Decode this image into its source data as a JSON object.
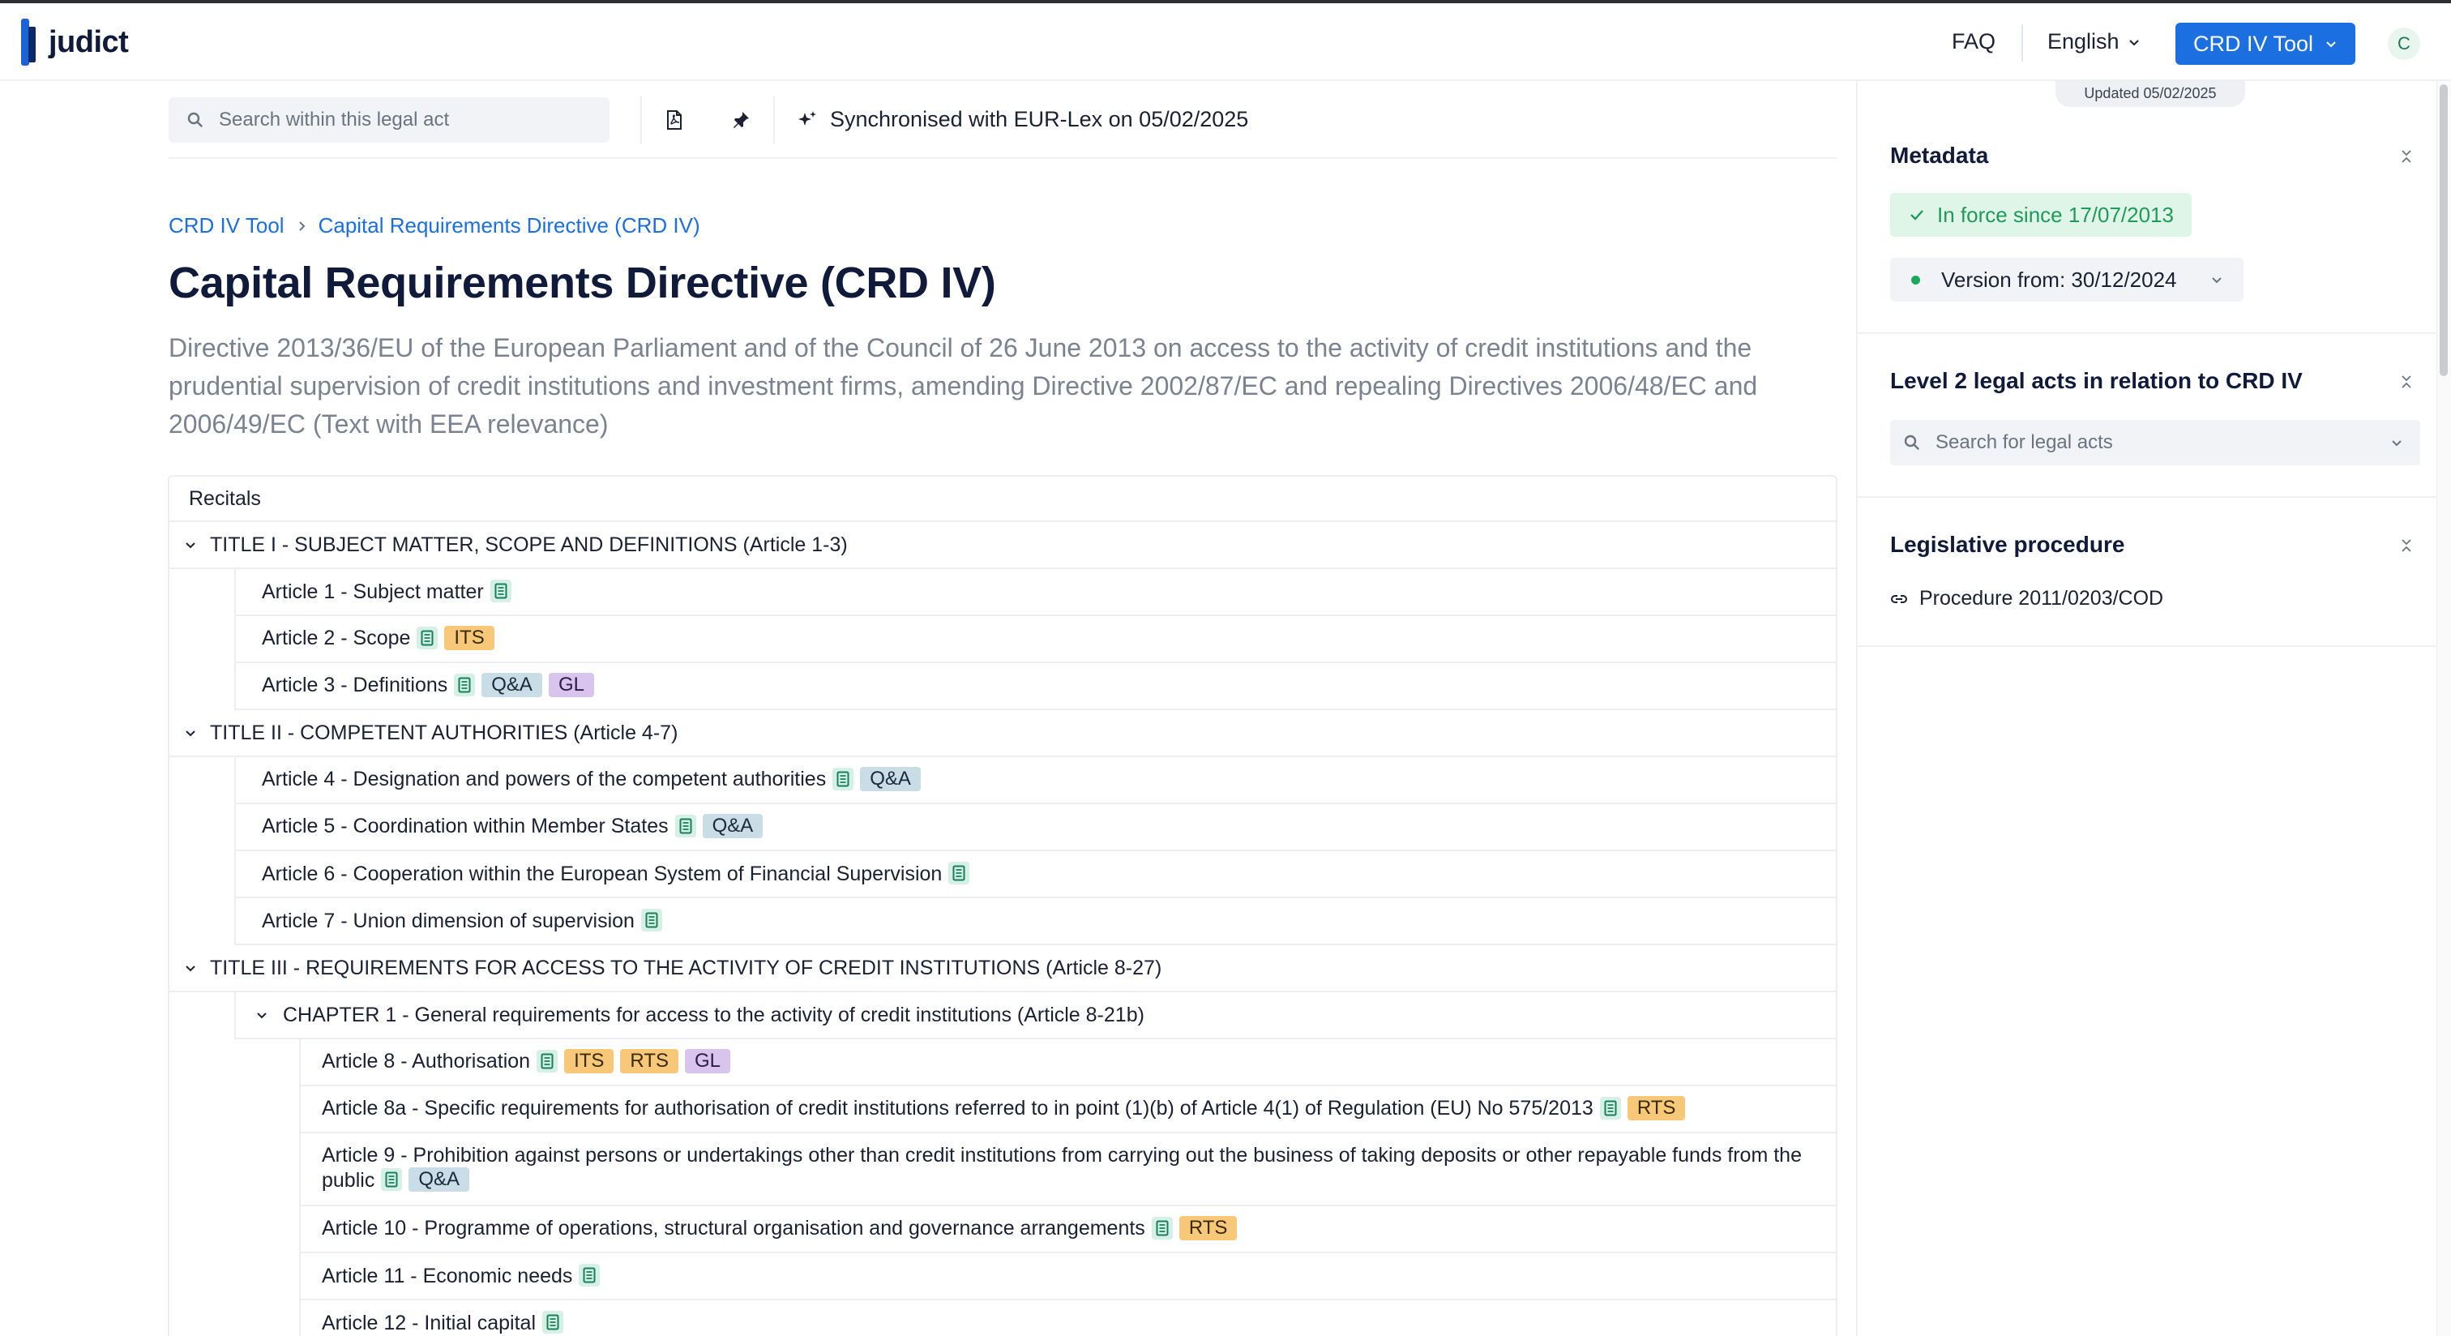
{
  "header": {
    "logo_text": "judict",
    "faq_label": "FAQ",
    "language_label": "English",
    "tool_button_label": "CRD IV Tool",
    "avatar_initial": "C",
    "brand_color": "#1c6fe0"
  },
  "toolbar": {
    "search_placeholder": "Search within this legal act",
    "sync_text": "Synchronised with EUR-Lex on 05/02/2025"
  },
  "breadcrumb": {
    "items": [
      "CRD IV Tool",
      "Capital Requirements Directive (CRD IV)"
    ]
  },
  "main": {
    "title": "Capital Requirements Directive (CRD IV)",
    "subtitle": "Directive 2013/36/EU of the European Parliament and of the Council of 26 June 2013 on access to the activity of credit institutions and the prudential supervision of credit institutions and investment firms, amending Directive 2002/87/EC and repealing Directives 2006/48/EC and 2006/49/EC (Text with EEA relevance)"
  },
  "toc": {
    "recitals": "Recitals",
    "title1": {
      "label": "TITLE I - SUBJECT MATTER, SCOPE AND DEFINITIONS",
      "range": "(Article 1-3)",
      "articles": [
        {
          "label": "Article 1 - Subject matter",
          "tags": []
        },
        {
          "label": "Article 2 - Scope",
          "tags": [
            "ITS"
          ]
        },
        {
          "label": "Article 3 - Definitions",
          "tags": [
            "Q&A",
            "GL"
          ]
        }
      ]
    },
    "title2": {
      "label": "TITLE II - COMPETENT AUTHORITIES",
      "range": "(Article 4-7)",
      "articles": [
        {
          "label": "Article 4 - Designation and powers of the competent authorities",
          "tags": [
            "Q&A"
          ]
        },
        {
          "label": "Article 5 - Coordination within Member States",
          "tags": [
            "Q&A"
          ]
        },
        {
          "label": "Article 6 - Cooperation within the European System of Financial Supervision",
          "tags": []
        },
        {
          "label": "Article 7 - Union dimension of supervision",
          "tags": []
        }
      ]
    },
    "title3": {
      "label": "TITLE III - REQUIREMENTS FOR ACCESS TO THE ACTIVITY OF CREDIT INSTITUTIONS",
      "range": "(Article 8-27)",
      "chapter1": {
        "label": "CHAPTER 1 - General requirements for access to the activity of credit institutions",
        "range": "(Article 8-21b)",
        "articles": [
          {
            "label": "Article 8 - Authorisation",
            "tags": [
              "ITS",
              "RTS",
              "GL"
            ]
          },
          {
            "label": "Article 8a - Specific requirements for authorisation of credit institutions referred to in point (1)(b) of Article 4(1) of Regulation (EU) No 575/2013",
            "tags": [
              "RTS"
            ]
          },
          {
            "label": "Article 9 - Prohibition against persons or undertakings other than credit institutions from carrying out the business of taking deposits or other repayable funds from the public",
            "tags": [
              "Q&A"
            ]
          },
          {
            "label": "Article 10 - Programme of operations, structural organisation and governance arrangements",
            "tags": [
              "RTS"
            ]
          },
          {
            "label": "Article 11 - Economic needs",
            "tags": []
          },
          {
            "label": "Article 12 - Initial capital",
            "tags": []
          }
        ]
      }
    }
  },
  "sidebar": {
    "updated_badge": "Updated 05/02/2025",
    "metadata": {
      "title": "Metadata",
      "in_force": "In force since 17/07/2013",
      "version": "Version from: 30/12/2024"
    },
    "level2": {
      "title": "Level 2 legal acts in relation to CRD IV",
      "search_placeholder": "Search for legal acts"
    },
    "procedure": {
      "title": "Legislative procedure",
      "link": "Procedure 2011/0203/COD"
    }
  },
  "colors": {
    "tag_its_rts": "#f7c878",
    "tag_qa": "#c9dde6",
    "tag_gl": "#d9c4ee",
    "doc_icon_bg": "#d7f0e7",
    "in_force_green": "#1f9a5a"
  }
}
